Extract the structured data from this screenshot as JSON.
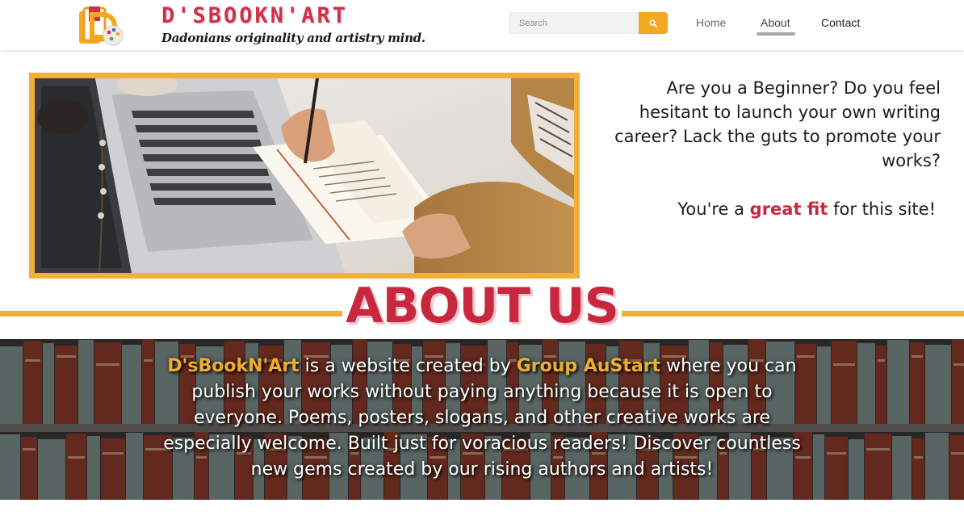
{
  "brand": {
    "title": "D'SBOOKN'ART",
    "tagline": "Dadonians originality and artistry mind.",
    "logo_icon": "dsbooknart-logo-icon"
  },
  "search": {
    "placeholder": "Search",
    "button_icon": "search-icon"
  },
  "nav": {
    "home": "Home",
    "about": "About",
    "contact": "Contact",
    "active": "About"
  },
  "hero": {
    "image_icon": "laptop-notebook-photo",
    "intro": "Are you a Beginner? Do you feel hesitant to launch your own writing career? Lack the guts to promote your works?",
    "fit_prefix": "You're a ",
    "fit_highlight": "great fit",
    "fit_suffix": " for this site!"
  },
  "about": {
    "title": "ABOUT US",
    "name_highlight": "D'sBookN'Art",
    "text_1": " is a website created by ",
    "group_highlight": "Group AuStart",
    "text_2": " where you can publish your works without paying anything because it is open to everyone. Poems, posters, slogans, and other creative works are especially welcome. Built just for voracious readers! Discover countless new gems created by our rising authors and artists!",
    "background_icon": "bookshelf-photo"
  },
  "colors": {
    "brand_red": "#c8283e",
    "accent_orange": "#f5a81c",
    "frame_yellow": "#f0b03a"
  }
}
